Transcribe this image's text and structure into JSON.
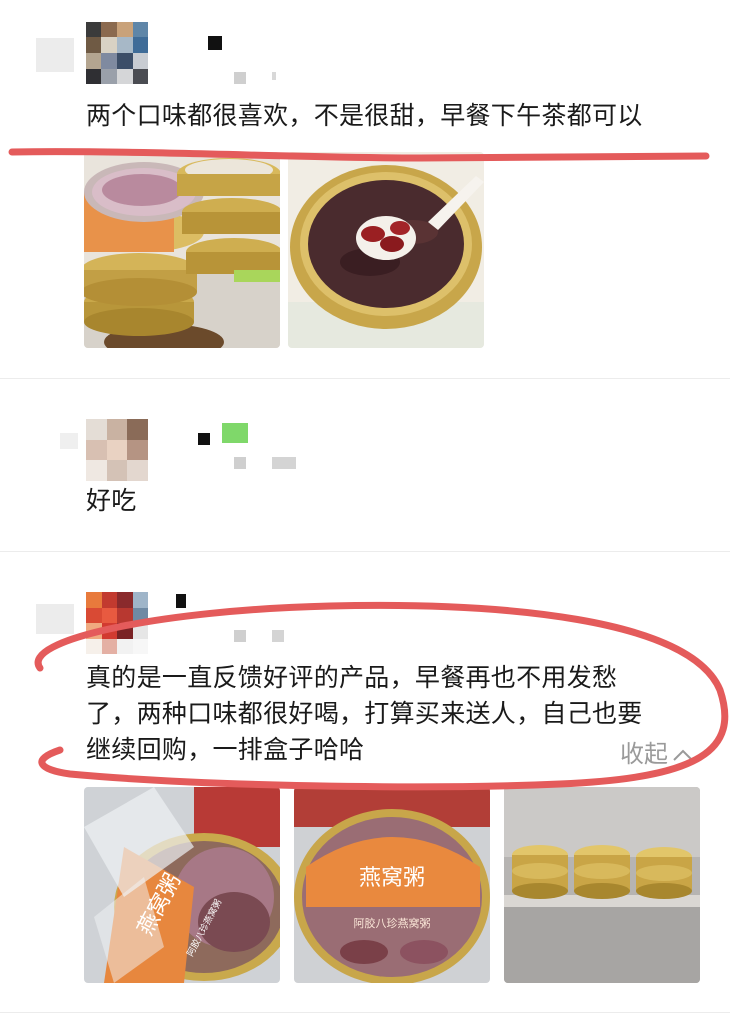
{
  "reviews": [
    {
      "text": "两个口味都很喜欢，不是很甜，早餐下午茶都可以",
      "photos": [
        "stacked-porridge-cans",
        "red-bean-porridge-spoon"
      ]
    },
    {
      "text": "好吃",
      "photos": []
    },
    {
      "line1": "真的是一直反馈好评的产品，早餐再也不用发愁",
      "line2": "了，两种口味都很好喝，打算买来送人，自己也要",
      "line3": "继续回购，一排盒子哈哈",
      "collapse_label": "收起",
      "photos": [
        "yanwo-porridge-can-wrapped",
        "yanwo-porridge-can-lid",
        "can-row-on-shelf"
      ],
      "can_label": "燕窝粥",
      "can_sublabel": "阿胶八珍燕窝粥"
    }
  ],
  "annotation_color": "#e45b5b"
}
